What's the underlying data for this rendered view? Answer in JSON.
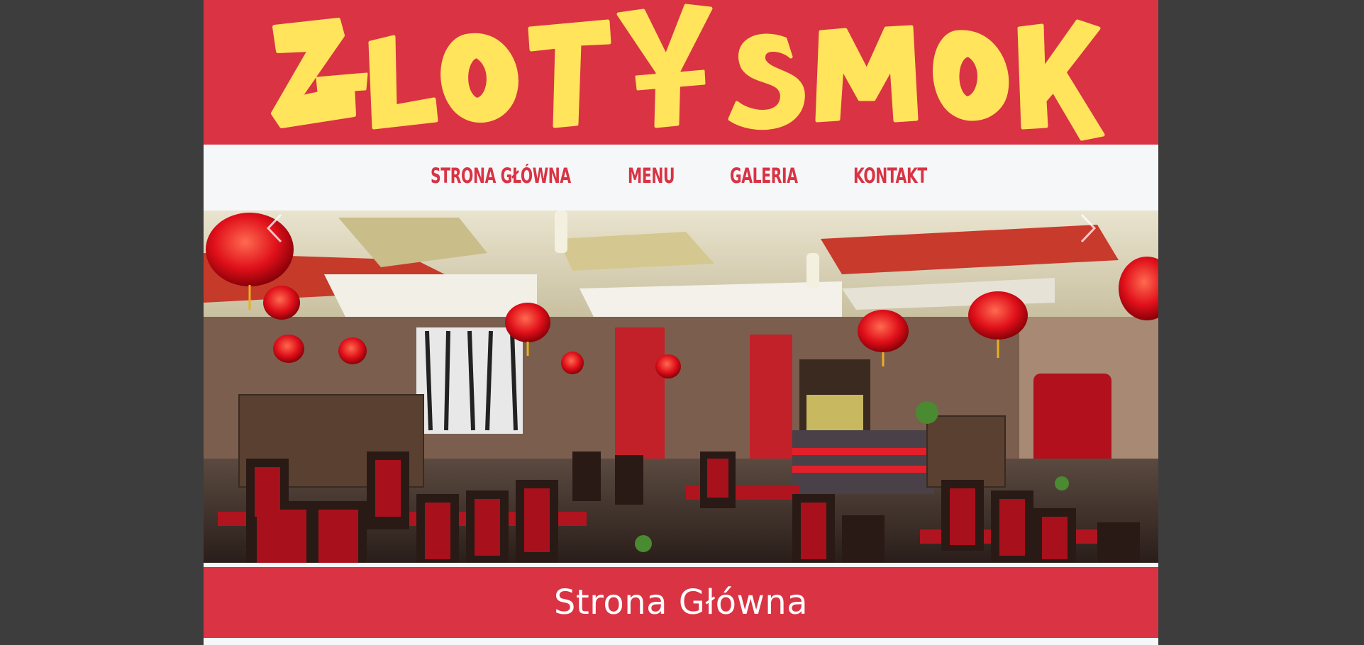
{
  "brand": {
    "logo_text": "ZŁOTY SMOK",
    "logo_color": "#ffe45c",
    "banner_color": "#d93344"
  },
  "nav": {
    "items": [
      {
        "label": "STRONA GŁÓWNA"
      },
      {
        "label": "MENU"
      },
      {
        "label": "GALERIA"
      },
      {
        "label": "KONTAKT"
      }
    ]
  },
  "slider": {
    "image": "restaurant-interior-photo",
    "prev_icon": "chevron-left-icon",
    "next_icon": "chevron-right-icon"
  },
  "page": {
    "title": "Strona Główna"
  },
  "colors": {
    "accent": "#d93344",
    "background": "#3d3d3d",
    "page": "#f6f7f9"
  }
}
